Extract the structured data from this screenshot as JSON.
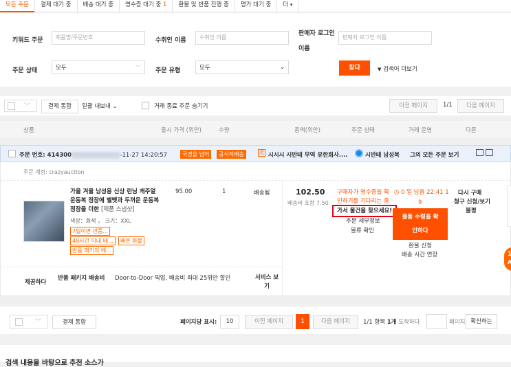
{
  "tabs": [
    {
      "label": "모든 주문",
      "count": ""
    },
    {
      "label": "결제 대기 중",
      "count": ""
    },
    {
      "label": "배송 대기 중",
      "count": ""
    },
    {
      "label": "영수증 대기 중",
      "count": "1"
    },
    {
      "label": "환불 및 반품 진행 중",
      "count": ""
    },
    {
      "label": "평가 대기 중",
      "count": ""
    },
    {
      "label": "더",
      "count": ""
    }
  ],
  "filter": {
    "keyword_label": "키워드 주문",
    "keyword_placeholder": "제품명/주문번호",
    "recipient_label": "수취인 이름",
    "recipient_placeholder": "수취인 이름",
    "seller_label_1": "판매자 로그인",
    "seller_label_2": "이름",
    "seller_placeholder": "판매자 로그인 이름",
    "status_label": "주문 상태",
    "status_value": "모두",
    "type_label": "주문 유형",
    "type_value": "모두",
    "search_button": "찾다",
    "more_search": "검색어 더보기"
  },
  "toolbar": {
    "merge_pay": "결제 통합",
    "bulk_export": "일괄 내보내",
    "hide_closed": "거래 종료 주문 숨기기",
    "prev_page": "이전 페이지",
    "page_indicator": "1/1",
    "next_page": "다음 페이지"
  },
  "columns": [
    "상품",
    "출시 가격 (위안)",
    "수량",
    "총액(위안)",
    "주문 상태",
    "거래 운영",
    "다른"
  ],
  "order": {
    "number_label": "주문 번호: 414300",
    "number_masked": "0000000000000",
    "date_suffix": "-11-27 14:20:57",
    "tag_crossborder": "국경을 넘어",
    "tag_official": "공식적배송",
    "shop_name": "시시시 시반테 무역 유한회사....",
    "ww_name": "시반테 남성복",
    "view_all": "그의 모든 주문 보기",
    "account_label": "주문 계정:",
    "account_value": "crazyauction",
    "product_title": "가을 겨울 남성용 신상 런닝 캐주얼 운동복 정장에 벨벳과 두꺼운 운동복 정장을 더한",
    "product_snapshot": "[제품 스냅샷]",
    "product_attrs": "색상：회색 ， 크기：XXL",
    "service_tags": [
      "7일이면 반품...",
      "48시간 이내 배...",
      "빠른 환불",
      "반품 패키지 배..."
    ],
    "price": "95.00",
    "qty": "1",
    "shipping_status": "배송됨",
    "total": "102.50",
    "shipping_incl": "배송비 포함 7.50",
    "status_line1": "구매자가 영수증을 확",
    "countdown": "0 일 남음 22:41 1",
    "status_line2": "인하기를 기다리는 중",
    "countdown2": "9",
    "tooltip": "가서 물건을 찾으세요!",
    "status_details": "주문 세부정보",
    "logistics": "물류 확인",
    "confirm_btn_1": "물품 수령을 확",
    "confirm_btn_2": "인하다",
    "refund_apply": "환불 신청",
    "extend_delivery": "배송 시간 연장",
    "buy_again": "다시 구매",
    "invoice_1": "청구 신청/보기",
    "complaint": "불평",
    "return_label": "제공하다",
    "return_fee_label": "반품 패키지 배송비",
    "return_desc": "Door-to-Door 픽업, 배송비 최대 25위안 할인",
    "service_view_1": "서비스 보",
    "service_view_2": "기"
  },
  "pagination": {
    "merge_pay": "결제 통합",
    "per_page_label": "페이지당 표시:",
    "per_page_value": "10",
    "prev_page": "이전 페이지",
    "current": "1",
    "next_page": "다음 페이지",
    "summary_a": "1/1 항목",
    "summary_b": "1개",
    "goto_label": "도착하다",
    "page_label": "페이지",
    "confirm": "확신하는"
  },
  "footer": {
    "text": "검색 내용을 바탕으로 추천 소스가"
  },
  "side_badge": {
    "text": "16",
    "sub": "A"
  }
}
